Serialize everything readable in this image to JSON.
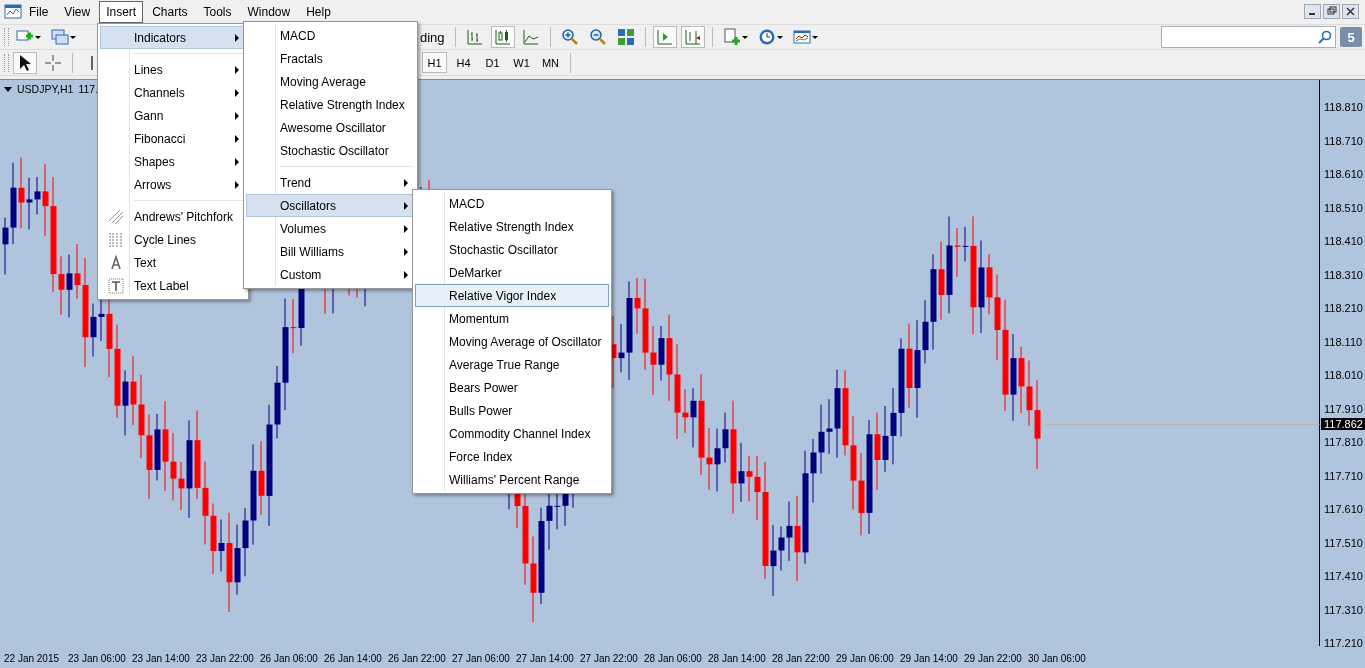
{
  "menu_bar": {
    "items": [
      {
        "label": "File",
        "selected": false
      },
      {
        "label": "View",
        "selected": false
      },
      {
        "label": "Insert",
        "selected": true
      },
      {
        "label": "Charts",
        "selected": false
      },
      {
        "label": "Tools",
        "selected": false
      },
      {
        "label": "Window",
        "selected": false
      },
      {
        "label": "Help",
        "selected": false
      }
    ]
  },
  "toolbar": {
    "partial_button_label": "ding",
    "notification_badge": "5"
  },
  "timeframes": [
    {
      "label": "H1",
      "selected": true
    },
    {
      "label": "H4",
      "selected": false
    },
    {
      "label": "D1",
      "selected": false
    },
    {
      "label": "W1",
      "selected": false
    },
    {
      "label": "MN",
      "selected": false
    }
  ],
  "chart": {
    "symbol": "USDJPY,H1",
    "partial_price": "117.",
    "price_labels": [
      "118.810",
      "118.710",
      "118.610",
      "118.510",
      "118.410",
      "118.310",
      "118.210",
      "118.110",
      "118.010",
      "117.910",
      "117.810",
      "117.710",
      "117.610",
      "117.510",
      "117.410",
      "117.310",
      "117.210"
    ],
    "current_price": "117.862",
    "time_labels": [
      "22 Jan 2015",
      "23 Jan 06:00",
      "23 Jan 14:00",
      "23 Jan 22:00",
      "26 Jan 06:00",
      "26 Jan 14:00",
      "26 Jan 22:00",
      "27 Jan 06:00",
      "27 Jan 14:00",
      "27 Jan 22:00",
      "28 Jan 06:00",
      "28 Jan 14:00",
      "28 Jan 22:00",
      "29 Jan 06:00",
      "29 Jan 14:00",
      "29 Jan 22:00",
      "30 Jan 06:00"
    ]
  },
  "insert_menu": {
    "items": [
      {
        "kind": "submenu",
        "label": "Indicators",
        "selected": true
      },
      {
        "kind": "separator"
      },
      {
        "kind": "submenu",
        "label": "Lines",
        "selected": false
      },
      {
        "kind": "submenu",
        "label": "Channels",
        "selected": false
      },
      {
        "kind": "submenu",
        "label": "Gann",
        "selected": false
      },
      {
        "kind": "submenu",
        "label": "Fibonacci",
        "selected": false
      },
      {
        "kind": "submenu",
        "label": "Shapes",
        "selected": false
      },
      {
        "kind": "submenu",
        "label": "Arrows",
        "selected": false
      },
      {
        "kind": "separator"
      },
      {
        "kind": "tool",
        "label": "Andrews' Pitchfork",
        "selected": false
      },
      {
        "kind": "tool",
        "label": "Cycle Lines",
        "selected": false
      },
      {
        "kind": "tool",
        "label": "Text",
        "selected": false
      },
      {
        "kind": "tool",
        "label": "Text Label",
        "selected": false
      }
    ]
  },
  "indicators_menu": {
    "items": [
      {
        "kind": "item",
        "label": "MACD",
        "selected": false
      },
      {
        "kind": "item",
        "label": "Fractals",
        "selected": false
      },
      {
        "kind": "item",
        "label": "Moving Average",
        "selected": false
      },
      {
        "kind": "item",
        "label": "Relative Strength Index",
        "selected": false
      },
      {
        "kind": "item",
        "label": "Awesome Oscillator",
        "selected": false
      },
      {
        "kind": "item",
        "label": "Stochastic Oscillator",
        "selected": false
      },
      {
        "kind": "separator"
      },
      {
        "kind": "submenu",
        "label": "Trend",
        "selected": false
      },
      {
        "kind": "submenu",
        "label": "Oscillators",
        "selected": true
      },
      {
        "kind": "submenu",
        "label": "Volumes",
        "selected": false
      },
      {
        "kind": "submenu",
        "label": "Bill Williams",
        "selected": false
      },
      {
        "kind": "submenu",
        "label": "Custom",
        "selected": false
      }
    ]
  },
  "oscillators_menu": {
    "items": [
      {
        "kind": "item",
        "label": "MACD",
        "selected": false
      },
      {
        "kind": "item",
        "label": "Relative Strength Index",
        "selected": false
      },
      {
        "kind": "item",
        "label": "Stochastic Oscillator",
        "selected": false
      },
      {
        "kind": "item",
        "label": "DeMarker",
        "selected": false
      },
      {
        "kind": "item",
        "label": "Relative Vigor Index",
        "selected": true
      },
      {
        "kind": "item",
        "label": "Momentum",
        "selected": false
      },
      {
        "kind": "item",
        "label": "Moving Average of Oscillator",
        "selected": false
      },
      {
        "kind": "item",
        "label": "Average True Range",
        "selected": false
      },
      {
        "kind": "item",
        "label": "Bears Power",
        "selected": false
      },
      {
        "kind": "item",
        "label": "Bulls Power",
        "selected": false
      },
      {
        "kind": "item",
        "label": "Commodity Channel Index",
        "selected": false
      },
      {
        "kind": "item",
        "label": "Force Index",
        "selected": false
      },
      {
        "kind": "item",
        "label": "Williams' Percent Range",
        "selected": false
      }
    ]
  }
}
